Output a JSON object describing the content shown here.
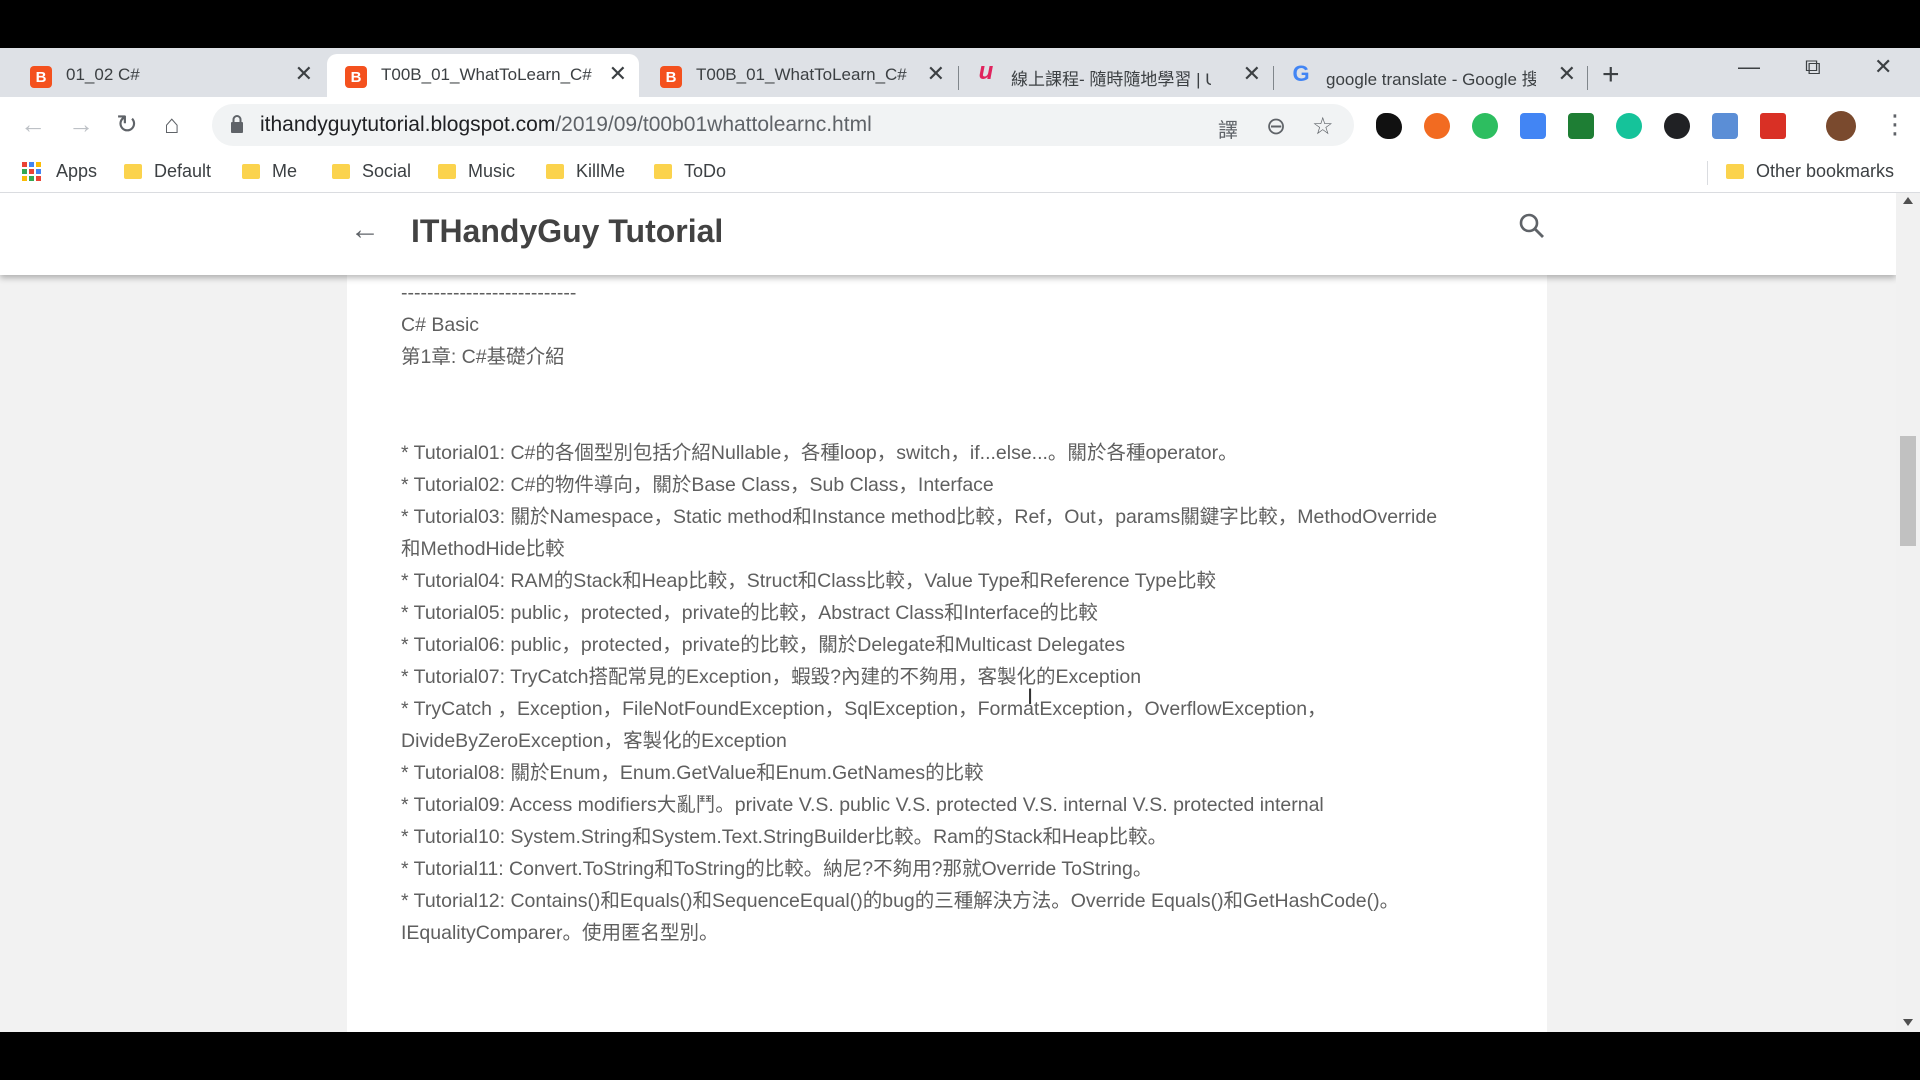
{
  "tabs": [
    {
      "title": "01_02 C#",
      "favicon": "blogger-icon",
      "active": false
    },
    {
      "title": "T00B_01_WhatToLearn_C#",
      "favicon": "blogger-icon",
      "active": true
    },
    {
      "title": "T00B_01_WhatToLearn_C#",
      "favicon": "blogger-icon",
      "active": false
    },
    {
      "title": "線上課程- 隨時隨地學習 | U",
      "favicon": "udemy-icon",
      "active": false
    },
    {
      "title": "google translate - Google 搜",
      "favicon": "google-icon",
      "active": false
    }
  ],
  "icons": {
    "blogger": "B",
    "udemy": "u",
    "google": "G",
    "close": "✕",
    "new_tab": "+",
    "back": "←",
    "forward": "→",
    "reload": "↻",
    "home": "⌂",
    "menu": "⋮",
    "minimize": "—",
    "restore": "⧉",
    "window_close": "✕",
    "translate": "譯",
    "zoom": "⊖",
    "star": "☆",
    "page_back": "←",
    "cursor": "I"
  },
  "address_bar": {
    "host": "ithandyguytutorial.blogspot.com",
    "path": "/2019/09/t00b01whattolearnc.html"
  },
  "bookmarks": {
    "apps": "Apps",
    "items": [
      "Default",
      "Me",
      "Social",
      "Music",
      "KillMe",
      "ToDo"
    ],
    "other": "Other bookmarks"
  },
  "blog": {
    "title": "ITHandyGuy Tutorial"
  },
  "post_lines": [
    "---------------------------",
    "C# Basic",
    "第1章: C#基礎介紹",
    "",
    "",
    "* Tutorial01: C#的各個型別包括介紹Nullable，各種loop，switch，if...else...。關於各種operator。",
    "* Tutorial02: C#的物件導向，關於Base Class，Sub Class，Interface",
    "* Tutorial03: 關於Namespace，Static method和Instance method比較，Ref，Out，params關鍵字比較，MethodOverride",
    "和MethodHide比較",
    "* Tutorial04: RAM的Stack和Heap比較，Struct和Class比較，Value Type和Reference Type比較",
    "* Tutorial05: public，protected，private的比較，Abstract Class和Interface的比較",
    "* Tutorial06: public，protected，private的比較，關於Delegate和Multicast Delegates",
    "* Tutorial07: TryCatch搭配常見的Exception，蝦毀?內建的不夠用，客製化的Exception",
    "   * TryCatch ，Exception，FileNotFoundException，SqlException，FormatException，OverflowException，",
    "DivideByZeroException，客製化的Exception",
    "* Tutorial08: 關於Enum，Enum.GetValue和Enum.GetNames的比較",
    "* Tutorial09: Access modifiers大亂鬥。private V.S. public V.S. protected V.S. internal V.S. protected internal",
    "* Tutorial10: System.String和System.Text.StringBuilder比較。Ram的Stack和Heap比較。",
    "* Tutorial11: Convert.ToString和ToString的比較。納尼?不夠用?那就Override ToString。",
    "* Tutorial12: Contains()和Equals()和SequenceEqual()的bug的三種解決方法。Override Equals()和GetHashCode()。",
    "IEqualityComparer。使用匿名型別。"
  ],
  "colors": {
    "tab_strip": "#dee1e6",
    "blogger_orange": "#f4511e",
    "folder_yellow": "#fbd34d",
    "text_gray": "#5f5f5f"
  }
}
